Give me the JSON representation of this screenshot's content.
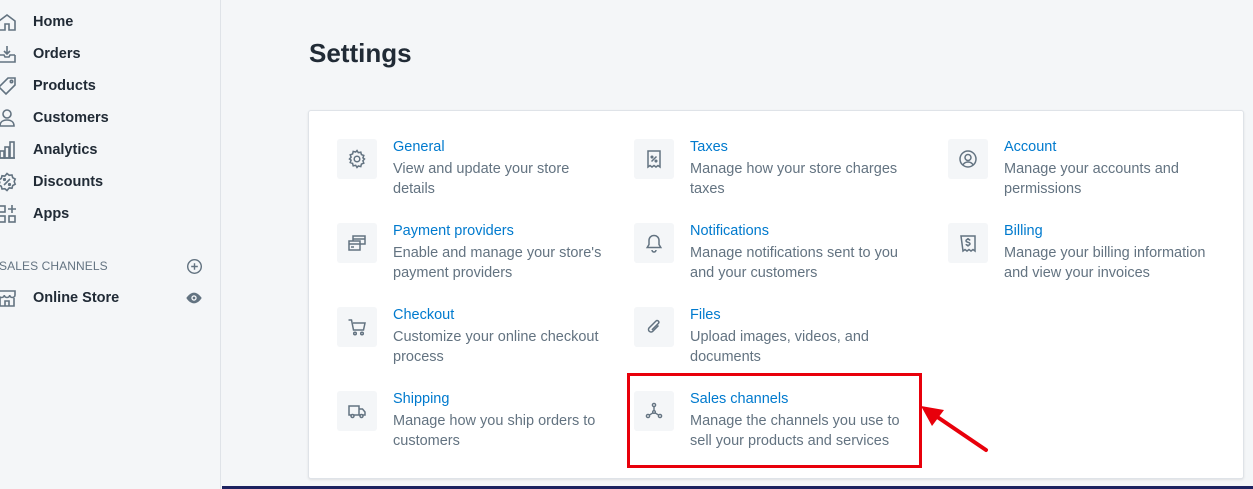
{
  "sidebar": {
    "items": [
      {
        "label": "Home",
        "icon": "home-icon"
      },
      {
        "label": "Orders",
        "icon": "orders-icon"
      },
      {
        "label": "Products",
        "icon": "tag-icon"
      },
      {
        "label": "Customers",
        "icon": "person-icon"
      },
      {
        "label": "Analytics",
        "icon": "bar-chart-icon"
      },
      {
        "label": "Discounts",
        "icon": "discount-icon"
      },
      {
        "label": "Apps",
        "icon": "apps-icon"
      }
    ],
    "sales_channels_label": "SALES CHANNELS",
    "online_store_label": "Online Store"
  },
  "main": {
    "title": "Settings",
    "settings": [
      {
        "title": "General",
        "desc": "View and update your store details",
        "icon": "gear-icon"
      },
      {
        "title": "Taxes",
        "desc": "Manage how your store charges taxes",
        "icon": "receipt-percent-icon"
      },
      {
        "title": "Account",
        "desc": "Manage your accounts and permissions",
        "icon": "account-circle-icon"
      },
      {
        "title": "Payment providers",
        "desc": "Enable and manage your store's payment providers",
        "icon": "credit-card-icon"
      },
      {
        "title": "Notifications",
        "desc": "Manage notifications sent to you and your customers",
        "icon": "bell-icon"
      },
      {
        "title": "Billing",
        "desc": "Manage your billing information and view your invoices",
        "icon": "invoice-dollar-icon"
      },
      {
        "title": "Checkout",
        "desc": "Customize your online checkout process",
        "icon": "cart-icon"
      },
      {
        "title": "Files",
        "desc": "Upload images, videos, and documents",
        "icon": "paperclip-icon"
      },
      {
        "title": "Shipping",
        "desc": "Manage how you ship orders to customers",
        "icon": "truck-icon"
      },
      {
        "title": "Sales channels",
        "desc": "Manage the channels you use to sell your products and services",
        "icon": "channels-icon"
      }
    ]
  },
  "colors": {
    "link": "#007ace",
    "highlight": "#e8000b",
    "text_subdued": "#637381"
  }
}
